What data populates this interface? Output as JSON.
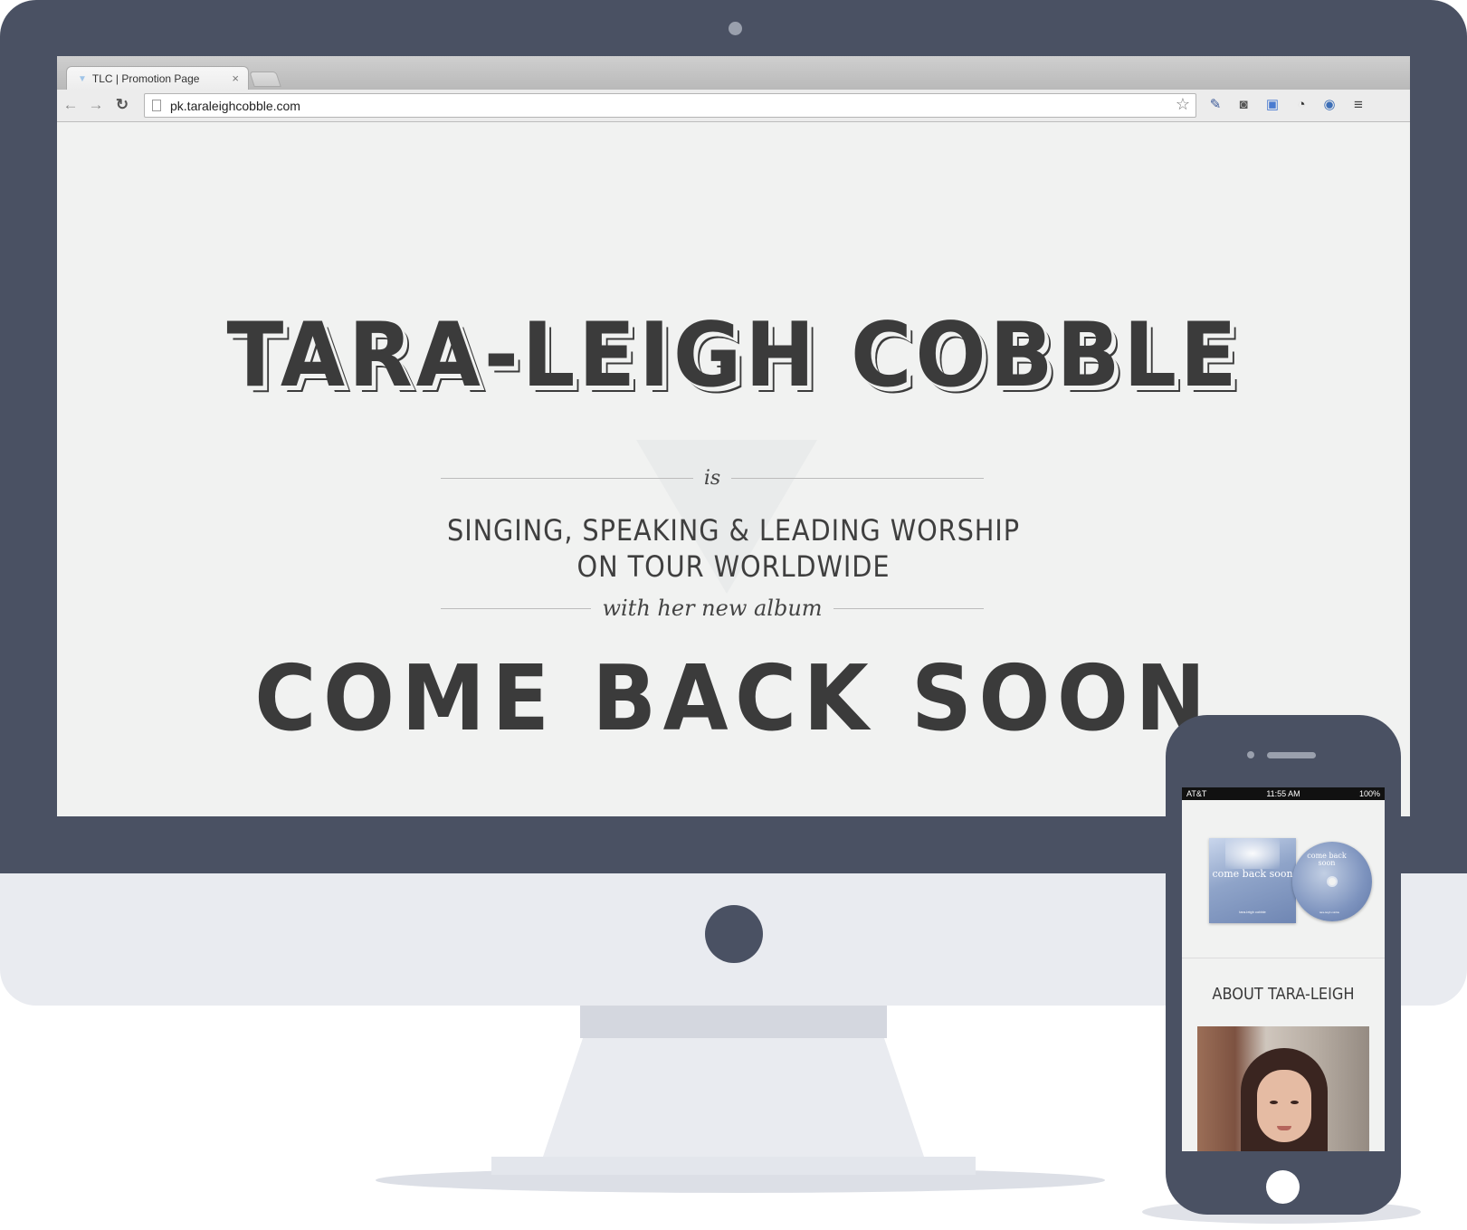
{
  "browser": {
    "tab_title": "TLC | Promotion Page",
    "tab_close": "×",
    "url": "pk.taraleighcobble.com"
  },
  "hero": {
    "artist_name": "TARA-LEIGH COBBLE",
    "is_word": "is",
    "tagline_line1": "SINGING, SPEAKING & LEADING WORSHIP",
    "tagline_line2": "ON TOUR WORLDWIDE",
    "with_album": "with her new album",
    "album_title": "COME BACK SOON"
  },
  "phone": {
    "carrier": "AT&T",
    "time": "11:55 AM",
    "battery": "100%",
    "cover_title": "come back soon",
    "cover_artist": "tara-leigh cobble",
    "about_heading": "ABOUT TARA-LEIGH"
  },
  "icons": {
    "back": "←",
    "forward": "→",
    "reload": "↻",
    "star": "☆",
    "ext_1": "✎",
    "ext_2": "◙",
    "ext_3": "▣",
    "ext_4": "◔",
    "ext_5": "◉",
    "ext_6": "≡"
  },
  "colors": {
    "bezel": "#4a5163",
    "body": "#e9ebf0",
    "page_bg": "#f1f2f1",
    "text_dark": "#3b3b3b"
  }
}
